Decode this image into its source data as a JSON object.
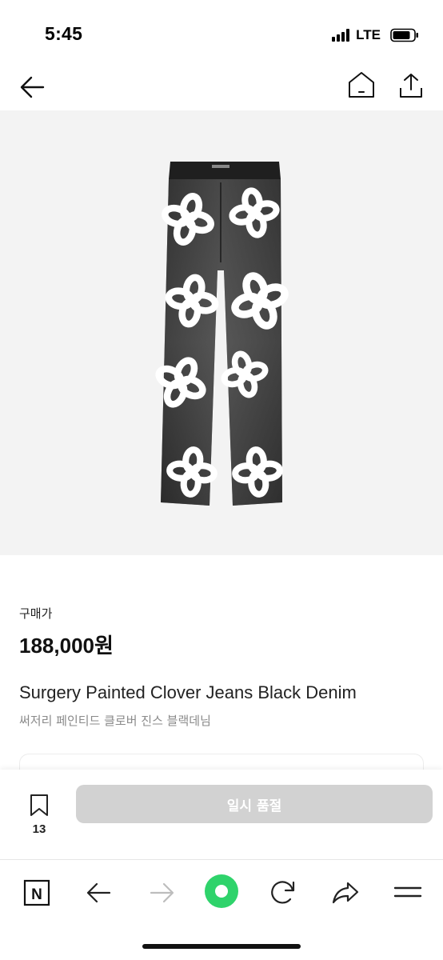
{
  "status_bar": {
    "time": "5:45",
    "network": "LTE",
    "icons": [
      "signal-icon",
      "battery-icon"
    ]
  },
  "top_nav": {
    "icons": [
      "back-arrow-icon",
      "home-icon",
      "share-icon"
    ]
  },
  "product": {
    "image_icon": "jeans-image",
    "price_label": "구매가",
    "price": "188,000원",
    "name_en": "Surgery Painted Clover Jeans Black Denim",
    "name_ko": "써저리 페인티드 클로버 진스 블랙데님"
  },
  "action_bar": {
    "bookmark_count": "13",
    "button_label": "일시 품절",
    "button_color": "#d2d2d2"
  },
  "browser_bar": {
    "icons": [
      "naver-n-icon",
      "back-icon",
      "forward-icon",
      "green-dot-icon",
      "reload-icon",
      "share-arrow-icon",
      "menu-icon"
    ],
    "accent": "#2fd36b"
  }
}
